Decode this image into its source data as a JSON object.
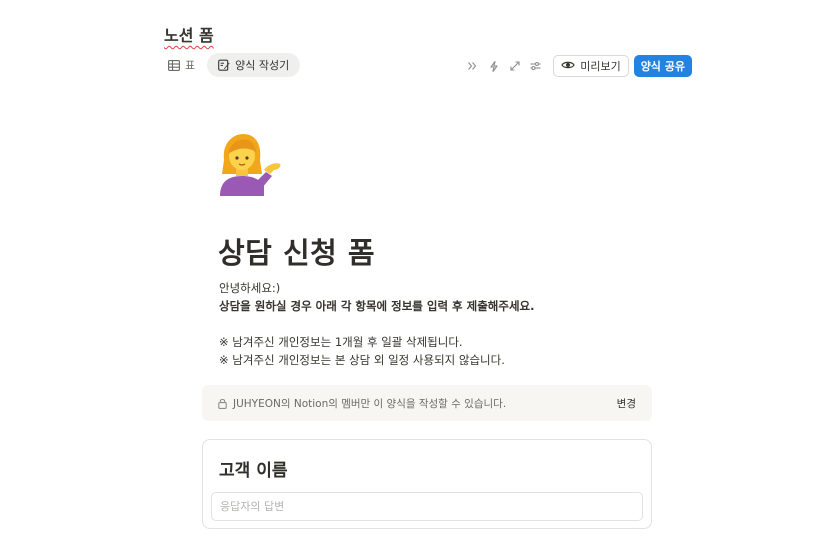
{
  "header": {
    "page_title": "노션 폼"
  },
  "views": {
    "table_label": "표",
    "form_builder_label": "양식 작성기"
  },
  "toolbar": {
    "icons": [
      "double-chevron-right-icon",
      "lightning-icon",
      "expand-icon",
      "sliders-icon"
    ],
    "preview_label": "미리보기",
    "share_label": "양식 공유"
  },
  "form": {
    "icon": "woman-tipping-hand-emoji",
    "title": "상담 신청 폼",
    "description": {
      "line1": "안녕하세요:)",
      "line2": "상담을 원하실 경우 아래 각 항목에 정보를 입력 후 제출해주세요.",
      "line3": "※ 남겨주신 개인정보는 1개월 후 일괄 삭제됩니다.",
      "line4": "※ 남겨주신 개인정보는 본 상담 외 일정 사용되지 않습니다."
    },
    "access_notice": "JUHYEON의 Notion의 멤버만 이 양식을 작성할 수 있습니다.",
    "access_change_label": "변경",
    "questions": [
      {
        "title": "고객 이름",
        "placeholder": "응답자의 답변"
      }
    ]
  },
  "colors": {
    "accent": "#2383e2",
    "text": "#37352f",
    "muted": "#6b6a66",
    "notice_bg": "#f7f6f3",
    "border": "#e3e2df"
  }
}
